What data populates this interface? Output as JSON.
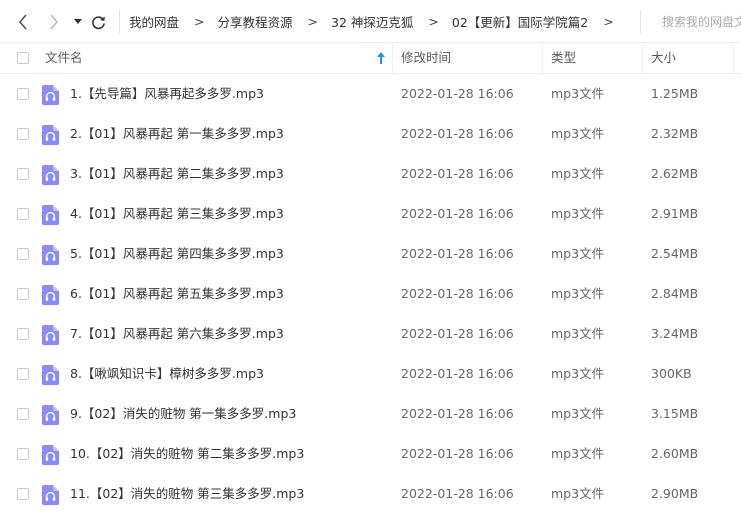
{
  "breadcrumb": {
    "items": [
      "我的网盘",
      "分享教程资源",
      "32 神探迈克狐",
      "02【更新】国际学院篇2"
    ],
    "separator": ">"
  },
  "search": {
    "placeholder": "搜索我的网盘文件"
  },
  "columns": {
    "name": "文件名",
    "modified": "修改时间",
    "type": "类型",
    "size": "大小"
  },
  "colors": {
    "icon_fill": "#8a8cf4",
    "text": "#333333",
    "sort_arrow": "#2f8cf4"
  },
  "files": [
    {
      "name": "1.【先导篇】风暴再起多多罗.mp3",
      "modified": "2022-01-28 16:06",
      "type": "mp3文件",
      "size": "1.25MB"
    },
    {
      "name": "2.【01】风暴再起 第一集多多罗.mp3",
      "modified": "2022-01-28 16:06",
      "type": "mp3文件",
      "size": "2.32MB"
    },
    {
      "name": "3.【01】风暴再起 第二集多多罗.mp3",
      "modified": "2022-01-28 16:06",
      "type": "mp3文件",
      "size": "2.62MB"
    },
    {
      "name": "4.【01】风暴再起 第三集多多罗.mp3",
      "modified": "2022-01-28 16:06",
      "type": "mp3文件",
      "size": "2.91MB"
    },
    {
      "name": "5.【01】风暴再起 第四集多多罗.mp3",
      "modified": "2022-01-28 16:06",
      "type": "mp3文件",
      "size": "2.54MB"
    },
    {
      "name": "6.【01】风暴再起 第五集多多罗.mp3",
      "modified": "2022-01-28 16:06",
      "type": "mp3文件",
      "size": "2.84MB"
    },
    {
      "name": "7.【01】风暴再起 第六集多多罗.mp3",
      "modified": "2022-01-28 16:06",
      "type": "mp3文件",
      "size": "3.24MB"
    },
    {
      "name": "8.【啾飒知识卡】樟树多多罗.mp3",
      "modified": "2022-01-28 16:06",
      "type": "mp3文件",
      "size": "300KB"
    },
    {
      "name": "9.【02】消失的赃物 第一集多多罗.mp3",
      "modified": "2022-01-28 16:06",
      "type": "mp3文件",
      "size": "3.15MB"
    },
    {
      "name": "10.【02】消失的赃物 第二集多多罗.mp3",
      "modified": "2022-01-28 16:06",
      "type": "mp3文件",
      "size": "2.60MB"
    },
    {
      "name": "11.【02】消失的赃物 第三集多多罗.mp3",
      "modified": "2022-01-28 16:06",
      "type": "mp3文件",
      "size": "2.90MB"
    }
  ]
}
